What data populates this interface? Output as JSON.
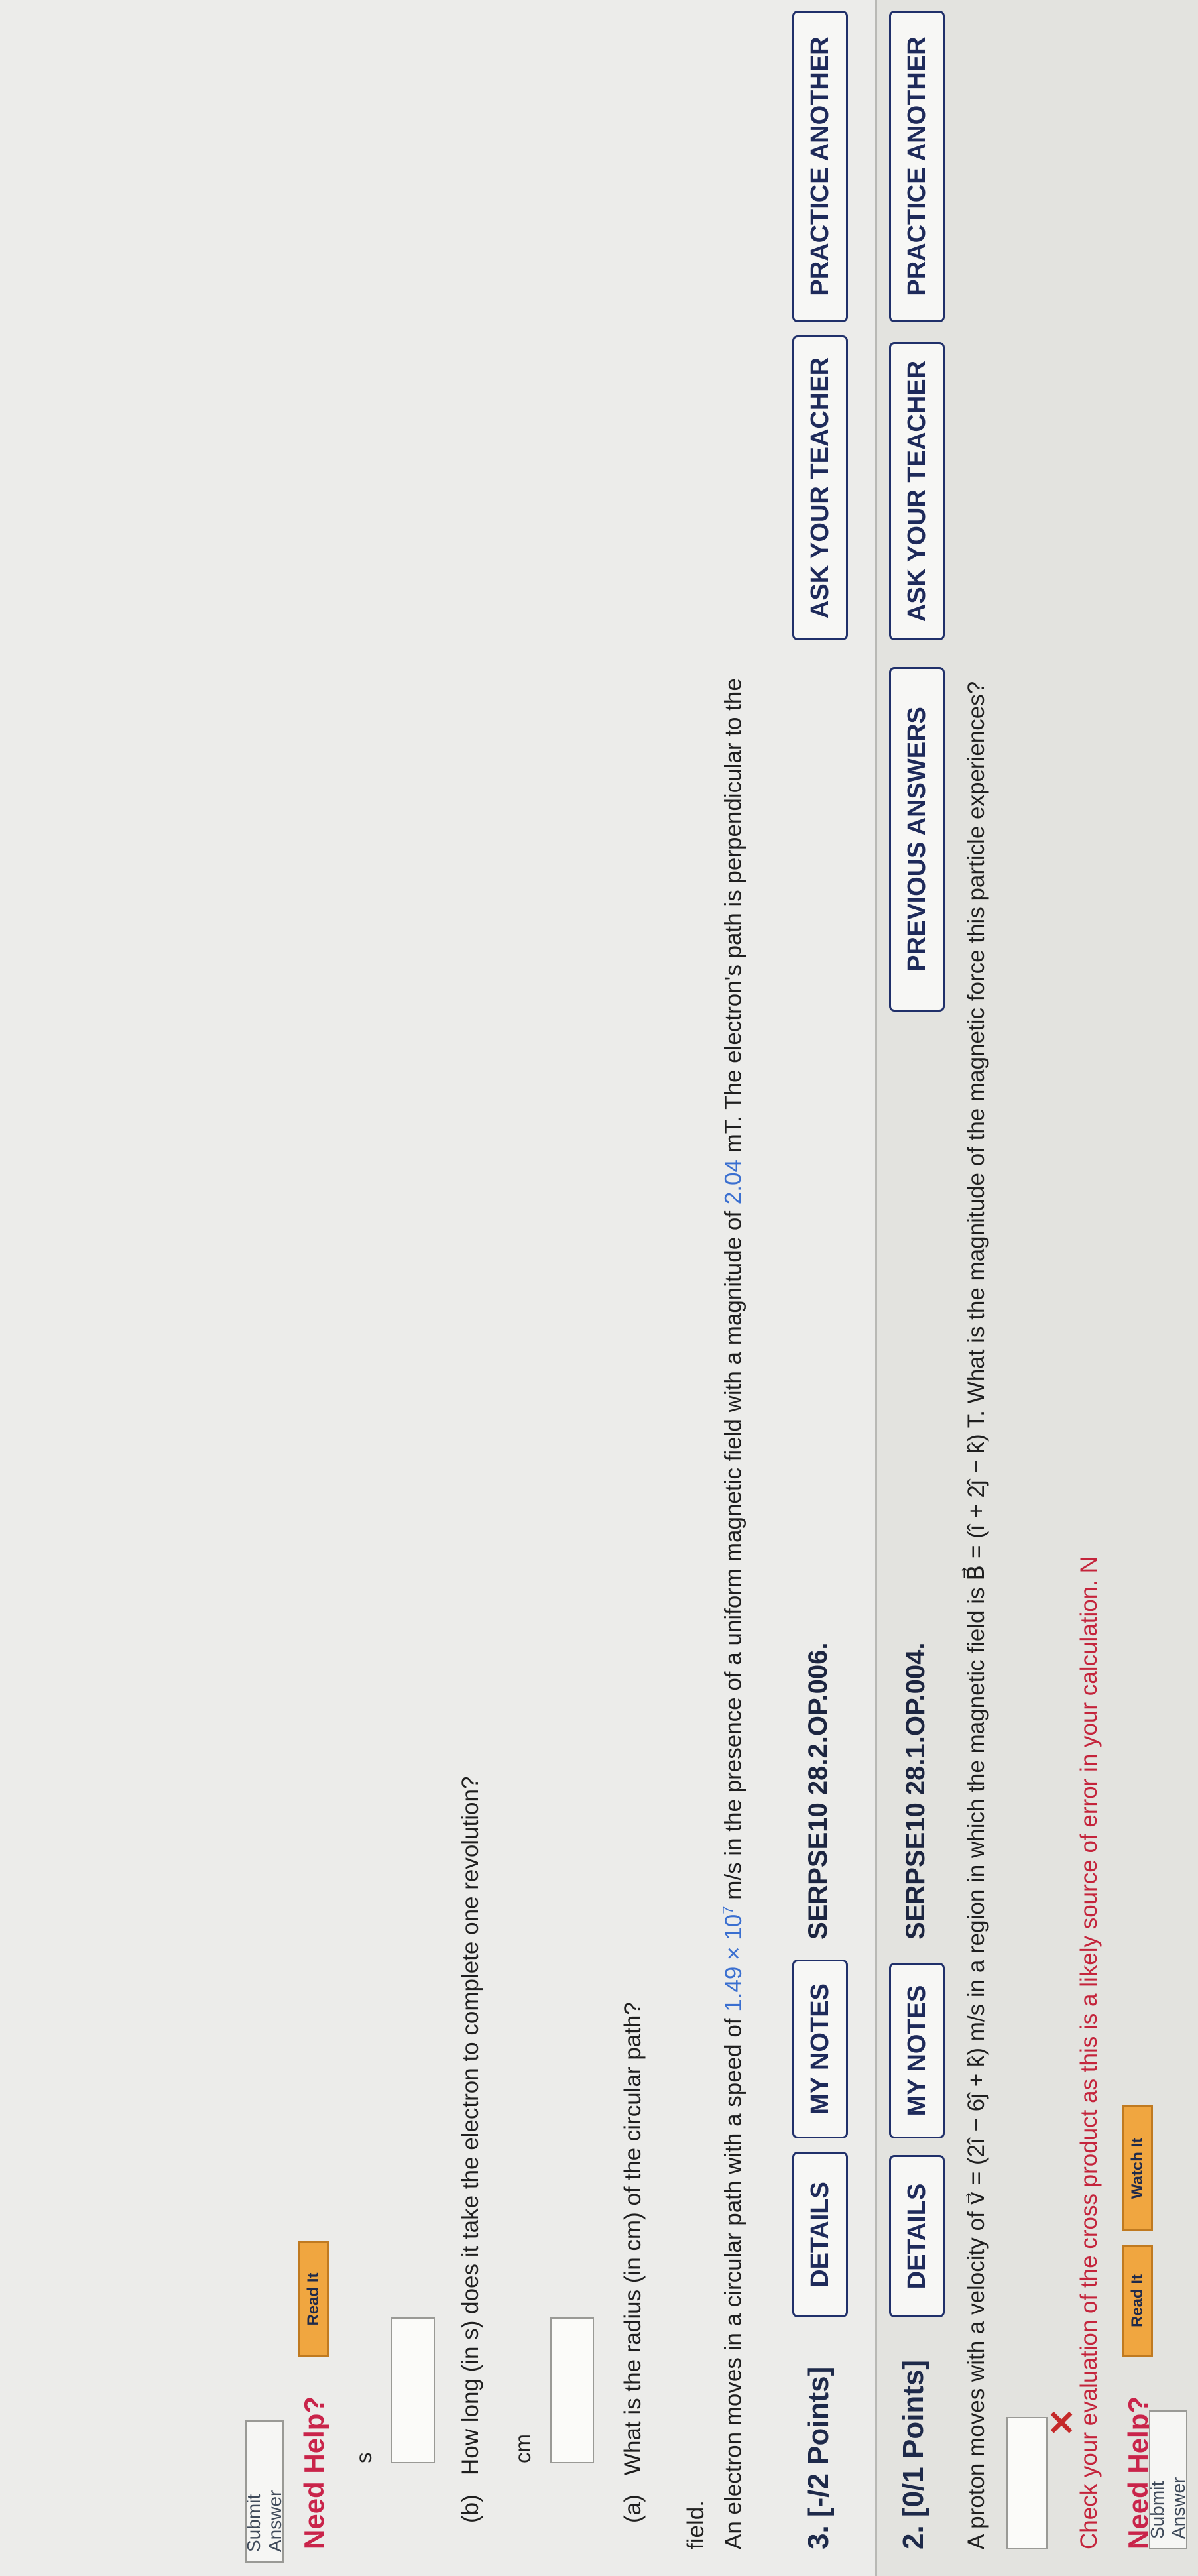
{
  "q2": {
    "number": "2.",
    "points": "[0/1 Points]",
    "details": "DETAILS",
    "my_notes": "MY NOTES",
    "ref": "SERPSE10 28.1.OP.004.",
    "previous_answers": "PREVIOUS ANSWERS",
    "ask_teacher": "ASK YOUR TEACHER",
    "practice_another": "PRACTICE ANOTHER",
    "question_part1": "A proton moves with a velocity of v⃗ = (2î − 6ĵ + k̂) m/s in a region in which the magnetic field is B⃗ = (î + 2ĵ − k̂) T. What is the magnitude of the magnetic force this particle experiences?",
    "feedback": "Check your evaluation of the cross product as this is a likely source of error in your calculation. N",
    "need_help": "Need Help?",
    "read_it": "Read It",
    "watch_it": "Watch It",
    "submit": "Submit Answer",
    "wrong_mark": "✕"
  },
  "q3": {
    "number": "3.",
    "points": "[-/2 Points]",
    "details": "DETAILS",
    "my_notes": "MY NOTES",
    "ref": "SERPSE10 28.2.OP.006.",
    "ask_teacher": "ASK YOUR TEACHER",
    "practice_another": "PRACTICE ANOTHER",
    "intro_a": "An electron moves in a circular path with a speed of ",
    "speed": "1.49 × 10",
    "speed_exp": "7",
    "intro_b": " m/s in the presence of a uniform magnetic field with a magnitude of ",
    "field": "2.04",
    "intro_c": " mT. The electron's path is perpendicular to the",
    "intro_line2": "field.",
    "part_a_label": "(a)",
    "part_a": "What is the radius (in cm) of the circular path?",
    "unit_a": "cm",
    "part_b_label": "(b)",
    "part_b": "How long (in s) does it take the electron to complete one revolution?",
    "unit_b": "s",
    "need_help": "Need Help?",
    "read_it": "Read It",
    "submit": "Submit Answer"
  }
}
